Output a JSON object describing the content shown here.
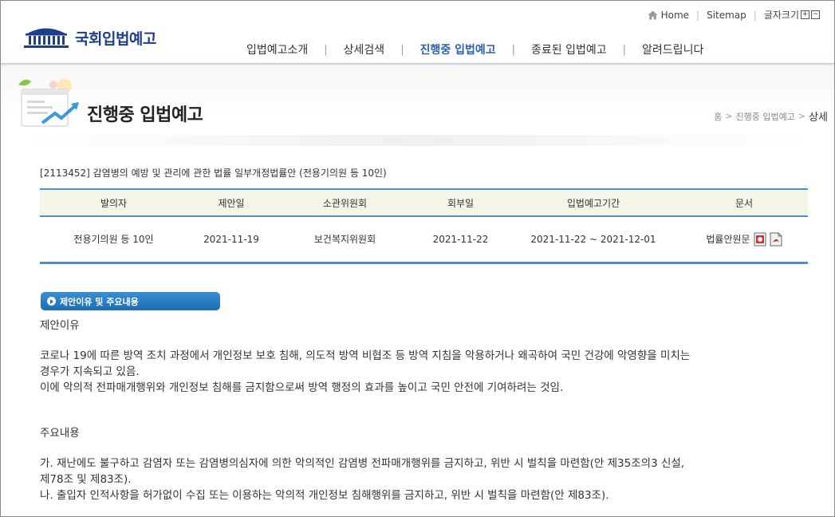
{
  "header": {
    "logo_text": "국회입법예고",
    "util": {
      "home": "Home",
      "sitemap": "Sitemap",
      "font_size": "글자크기",
      "font_plus": "+",
      "font_minus": "−"
    },
    "nav": [
      {
        "label": "입법예고소개"
      },
      {
        "label": "상세검색"
      },
      {
        "label": "진행중 입법예고"
      },
      {
        "label": "종료된 입법예고"
      },
      {
        "label": "알려드립니다"
      }
    ]
  },
  "title_area": {
    "title": "진행중 입법예고",
    "breadcrumb": {
      "home": "홈",
      "section": "진행중 입법예고",
      "current": "상세"
    }
  },
  "bill": {
    "title": "[2113452] 감염병의 예방 및 관리에 관한 법률 일부개정법률안 (전용기의원 등 10인)",
    "headers": [
      "발의자",
      "제안일",
      "소관위원회",
      "회부일",
      "입법예고기간",
      "문서"
    ],
    "row": {
      "proposer": "전용기의원 등 10인",
      "proposed_date": "2021-11-19",
      "committee": "보건복지위원회",
      "referral_date": "2021-11-22",
      "period": "2021-11-22 ~ 2021-12-01",
      "document_label": "법률안원문"
    }
  },
  "section": {
    "badge": "제안이유 및 주요내용",
    "reason_heading": "제안이유",
    "reason_p1": "코로나 19에 따른 방역 조치 과정에서 개인정보 보호 침해, 의도적 방역 비협조 등 방역 지침을 악용하거나 왜곡하여 국민 건강에 악영향을 미치는\n경우가 지속되고 있음.",
    "reason_p2": "이에 악의적 전파매개행위와 개인정보 침해를 금지함으로써 방역 행정의 효과를 높이고 국민 안전에 기여하려는 것임.",
    "main_heading": "주요내용",
    "main_item1": "가. 재난에도 불구하고 감염자 또는 감염병의심자에 의한 악의적인 감염병 전파매개행위를 금지하고, 위반 시 벌칙을 마련함(안 제35조의3 신설,\n제78조 및 제83조).",
    "main_item2": "나. 출입자 인적사항을 허가없이 수집 또는 이용하는 악의적 개인정보 침해행위를 금지하고, 위반 시 벌칙을 마련함(안 제83조)."
  },
  "colors": {
    "accent": "#2c5fae",
    "table_line": "#4d8fc6",
    "badge": "#1d6db5"
  }
}
